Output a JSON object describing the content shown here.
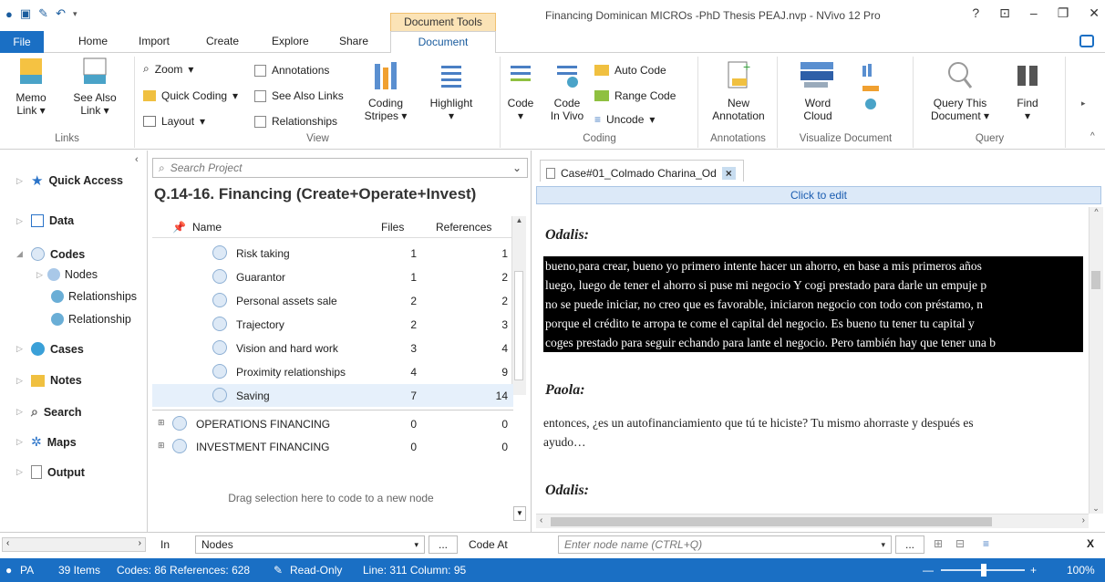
{
  "window": {
    "title": "Financing Dominican MICROs -PhD Thesis PEAJ.nvp - NVivo 12 Pro",
    "context_tab": "Document Tools"
  },
  "tabs": [
    "File",
    "Home",
    "Import",
    "Create",
    "Explore",
    "Share",
    "Document"
  ],
  "ribbon": {
    "links": {
      "memo_link": "Memo\nLink",
      "see_also_link": "See Also\nLink",
      "label": "Links"
    },
    "view": {
      "zoom": "Zoom",
      "quick_coding": "Quick Coding",
      "layout": "Layout",
      "annotations": "Annotations",
      "see_also_links": "See Also Links",
      "relationships": "Relationships",
      "coding_stripes": "Coding\nStripes",
      "highlight": "Highlight",
      "label": "View"
    },
    "coding": {
      "code": "Code",
      "code_in_vivo": "Code\nIn Vivo",
      "auto_code": "Auto Code",
      "range_code": "Range Code",
      "uncode": "Uncode",
      "label": "Coding"
    },
    "annotations": {
      "new_annotation": "New\nAnnotation",
      "label": "Annotations"
    },
    "visualize": {
      "word_cloud": "Word\nCloud",
      "label": "Visualize Document"
    },
    "query": {
      "query_this": "Query This\nDocument",
      "find": "Find",
      "label": "Query"
    }
  },
  "nav": {
    "quick_access": "Quick Access",
    "data": "Data",
    "codes": "Codes",
    "nodes": "Nodes",
    "relationships": "Relationships",
    "relationship": "Relationship",
    "cases": "Cases",
    "notes": "Notes",
    "search": "Search",
    "maps": "Maps",
    "output": "Output"
  },
  "middle": {
    "search_placeholder": "Search Project",
    "title": "Q.14-16. Financing (Create+Operate+Invest)",
    "headers": {
      "name": "Name",
      "files": "Files",
      "references": "References"
    },
    "rows": [
      {
        "name": "Risk taking",
        "files": "1",
        "refs": "1"
      },
      {
        "name": "Guarantor",
        "files": "1",
        "refs": "2"
      },
      {
        "name": "Personal assets sale",
        "files": "2",
        "refs": "2"
      },
      {
        "name": "Trajectory",
        "files": "2",
        "refs": "3"
      },
      {
        "name": "Vision and hard work",
        "files": "3",
        "refs": "4"
      },
      {
        "name": "Proximity relationships",
        "files": "4",
        "refs": "9"
      },
      {
        "name": "Saving",
        "files": "7",
        "refs": "14"
      }
    ],
    "top_rows": [
      {
        "name": "OPERATIONS FINANCING",
        "files": "0",
        "refs": "0"
      },
      {
        "name": "INVESTMENT FINANCING",
        "files": "0",
        "refs": "0"
      }
    ],
    "drag_hint": "Drag selection here to code to a new node"
  },
  "document": {
    "tab_name": "Case#01_Colmado Charina_Od",
    "click_to_edit": "Click to edit",
    "speaker1": "Odalis:",
    "hl_lines": [
      "bueno,para crear, bueno yo primero intente hacer un ahorro, en base a mis primeros años",
      "luego, luego de tener el ahorro  si puse mi negocio Y cogi prestado para darle un empuje p",
      "no se puede iniciar, no creo que es favorable, iniciaron negocio con todo con préstamo, n",
      "porque el crédito te arropa te come el capital del negocio. Es bueno tu  tener tu capital y",
      "coges prestado para seguir echando para lante el negocio.  Pero también hay que tener una b"
    ],
    "speaker2": "Paola:",
    "paola_lines": [
      "entonces, ¿es un autofinanciamiento  que tú te hiciste?  Tu mismo ahorraste y después es",
      "ayudo…"
    ],
    "speaker3": "Odalis:"
  },
  "codebar": {
    "in_label": "In",
    "in_value": "Nodes",
    "ellipsis": "...",
    "code_at": "Code At",
    "node_placeholder": "Enter node name (CTRL+Q)",
    "close": "X"
  },
  "status": {
    "user": "PA",
    "items": "39 Items",
    "codes": "Codes: 86  References: 628",
    "readonly": "Read-Only",
    "line": "Line: 311  Column: 95",
    "zoom": "100%"
  }
}
